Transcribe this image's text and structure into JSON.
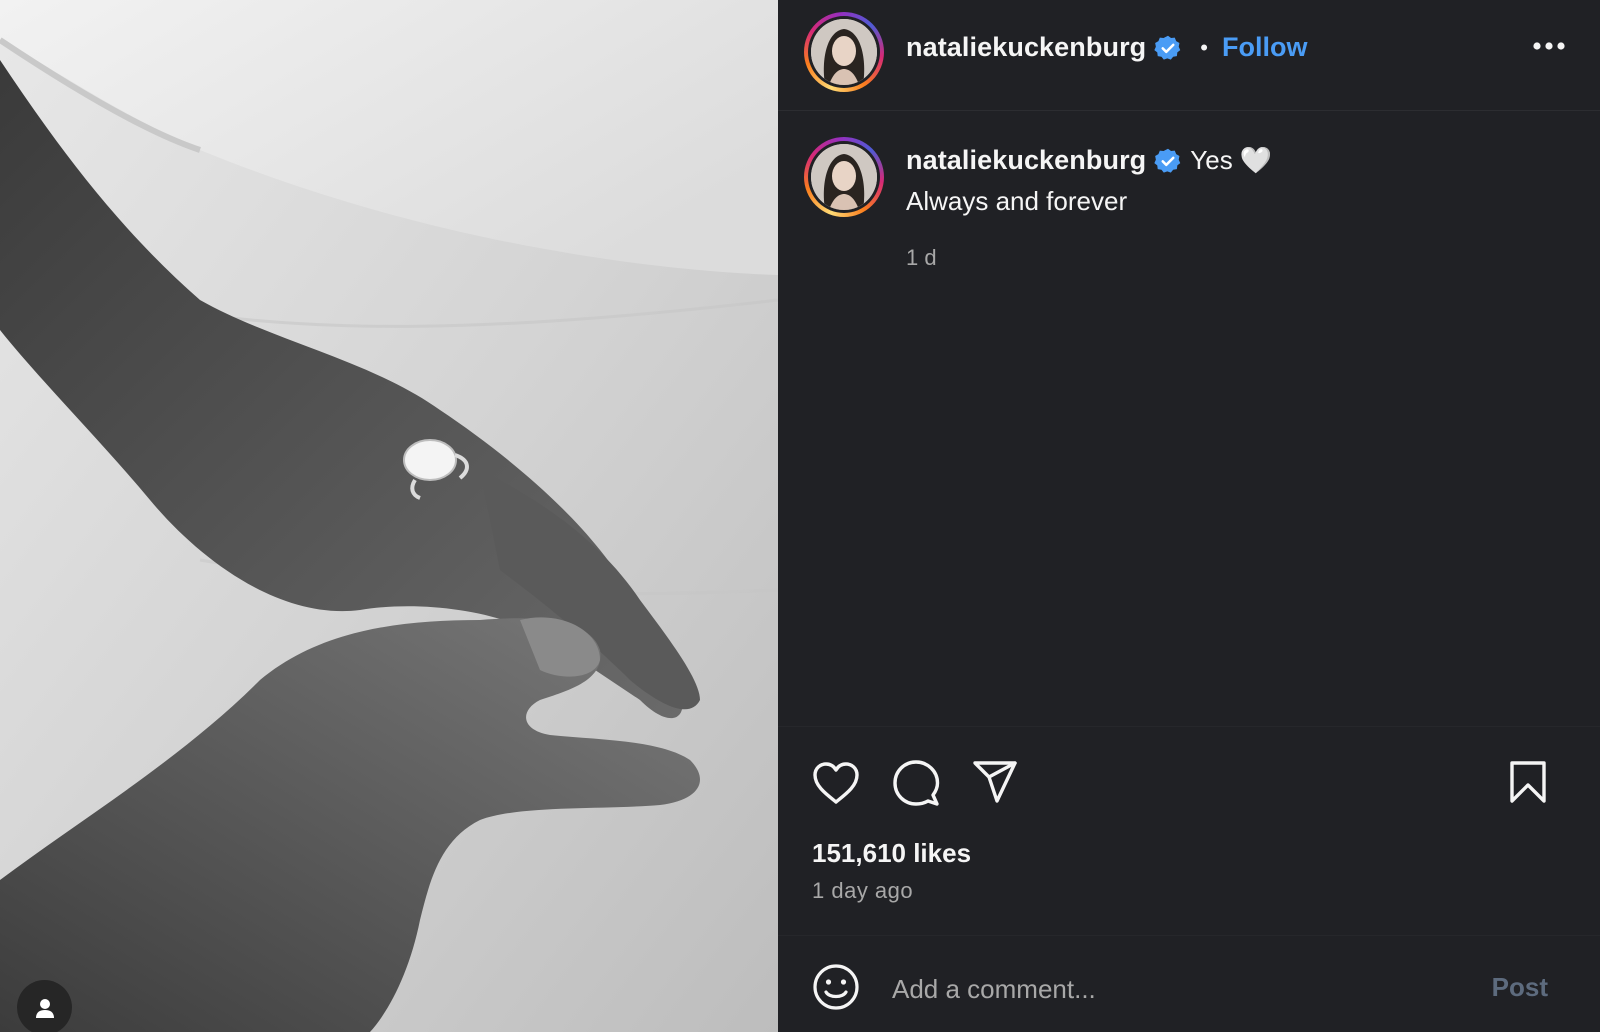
{
  "post": {
    "image_alt": "Black and white photo of two hands holding, one wearing a diamond engagement ring",
    "username": "nataliekuckenburg",
    "verified": true,
    "separator": "•",
    "follow_label": "Follow",
    "more_icon": "more-horizontal-icon"
  },
  "caption": {
    "username": "nataliekuckenburg",
    "text": "Yes 🤍",
    "line2": "Always and forever",
    "time": "1 d"
  },
  "actions": {
    "like_icon": "heart-icon",
    "comment_icon": "comment-icon",
    "share_icon": "send-icon",
    "save_icon": "bookmark-icon"
  },
  "stats": {
    "likes": "151,610 likes",
    "posted": "1 day ago"
  },
  "comment": {
    "placeholder": "Add a comment...",
    "post_label": "Post",
    "emoji_icon": "smiley-icon"
  },
  "colors": {
    "background": "#202125",
    "follow": "#4a9cf5",
    "verified": "#4a9cf5",
    "muted": "#a8a8a8",
    "post_disabled": "#5d6b7e"
  }
}
